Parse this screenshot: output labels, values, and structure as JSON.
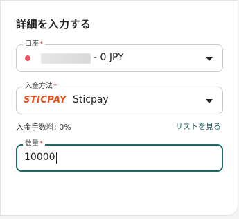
{
  "form": {
    "title": "詳細を入力する",
    "account": {
      "label": "口座",
      "required_mark": "*",
      "value": "- 0 JPY",
      "status_color": "#ee5568"
    },
    "method": {
      "label": "入金方法",
      "required_mark": "*",
      "logo_text": "STICPAY",
      "value": "Sticpay",
      "logo_color": "#e8531e"
    },
    "fee": {
      "text": "入金手数料: 0%"
    },
    "list_link": "リストを見る",
    "amount": {
      "label": "数量",
      "required_mark": "*",
      "value": "10000"
    },
    "accent_color": "#1e6b67"
  }
}
